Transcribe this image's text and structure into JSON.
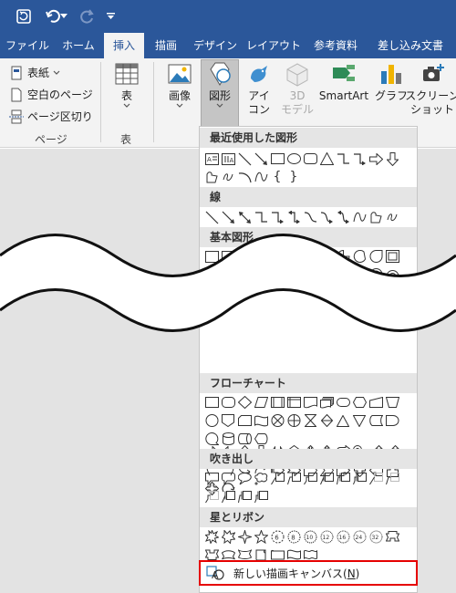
{
  "quick_access": {
    "icons": [
      "autosave-icon",
      "undo-icon",
      "redo-icon",
      "customize-qat-icon"
    ]
  },
  "tabs": [
    "ファイル",
    "ホーム",
    "挿入",
    "描画",
    "デザイン",
    "レイアウト",
    "参考資料",
    "差し込み文書"
  ],
  "active_tab": "挿入",
  "ribbon": {
    "pages_group": {
      "cover_page": "表紙",
      "blank_page": "空白のページ",
      "page_break": "ページ区切り",
      "label": "ページ"
    },
    "table_group": {
      "table": "表",
      "label": "表"
    },
    "illustrations": {
      "pictures": "画像",
      "shapes": "図形",
      "icons_line1": "アイ",
      "icons_line2": "コン",
      "models_line1": "3D",
      "models_line2": "モデル",
      "smartart": "SmartArt",
      "chart": "グラフ",
      "screenshot_line1": "スクリーン",
      "screenshot_line2": "ショット"
    }
  },
  "shapes_menu": {
    "sections": {
      "recent": "最近使用した図形",
      "lines": "線",
      "basic": "基本図形",
      "flowchart": "フローチャート",
      "callouts": "吹き出し",
      "stars": "星とリボン"
    },
    "recent_text_glyphs": [
      "{",
      "}"
    ],
    "new_canvas": {
      "label": "新しい描画キャンバス(",
      "accesskey": "N",
      "suffix": ")"
    }
  },
  "colors": {
    "accent": "#2b579a",
    "ribbon_bg": "#f3f3f3",
    "doc_bg": "#e3e3e3",
    "highlight_border": "#e60000"
  }
}
